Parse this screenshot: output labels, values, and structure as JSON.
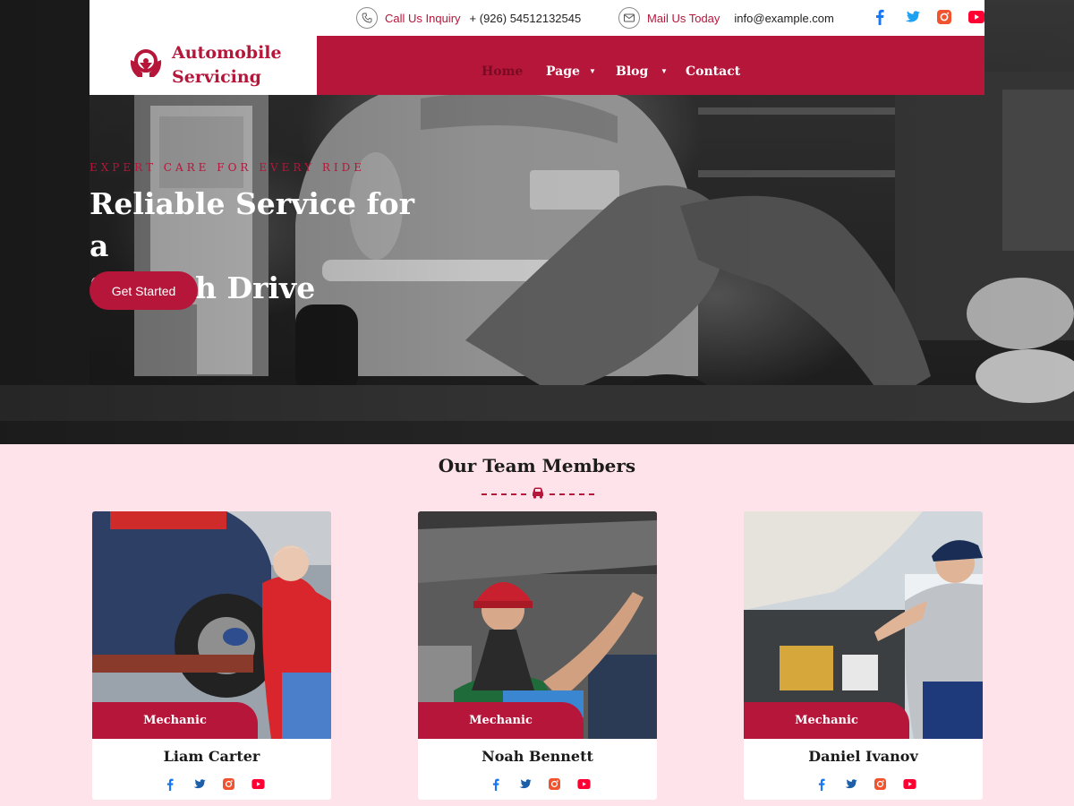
{
  "topbar": {
    "phone_label": "Call Us Inquiry",
    "phone_value": "+ (926) 54512132545",
    "mail_label": "Mail Us Today",
    "mail_value": "info@example.com",
    "socials": [
      "facebook-icon",
      "twitter-icon",
      "instagram-icon",
      "youtube-icon"
    ]
  },
  "brand": {
    "line1": "Automobile",
    "line2": "Servicing",
    "logo_icon": "steering-wheel-hands-icon"
  },
  "nav": {
    "items": [
      {
        "label": "Home",
        "active": true
      },
      {
        "label": "Page",
        "has_dropdown": true
      },
      {
        "label": "Blog",
        "has_dropdown": true
      },
      {
        "label": "Contact"
      }
    ]
  },
  "hero": {
    "eyebrow": "EXPERT CARE FOR EVERY RIDE",
    "title_line1": "Reliable Service for a",
    "title_line2": "Smooth Drive",
    "cta_label": "Get Started"
  },
  "team": {
    "heading": "Our Team Members",
    "members": [
      {
        "role": "Mechanic",
        "name": "Liam Carter"
      },
      {
        "role": "Mechanic",
        "name": "Noah Bennett"
      },
      {
        "role": "Mechanic",
        "name": "Daniel Ivanov"
      }
    ]
  },
  "colors": {
    "accent": "#b5163a",
    "section_bg": "#ffe3ea",
    "facebook": "#1877f2",
    "twitter": "#1da1f2",
    "instagram": "#f0532d",
    "youtube": "#ff0033"
  }
}
